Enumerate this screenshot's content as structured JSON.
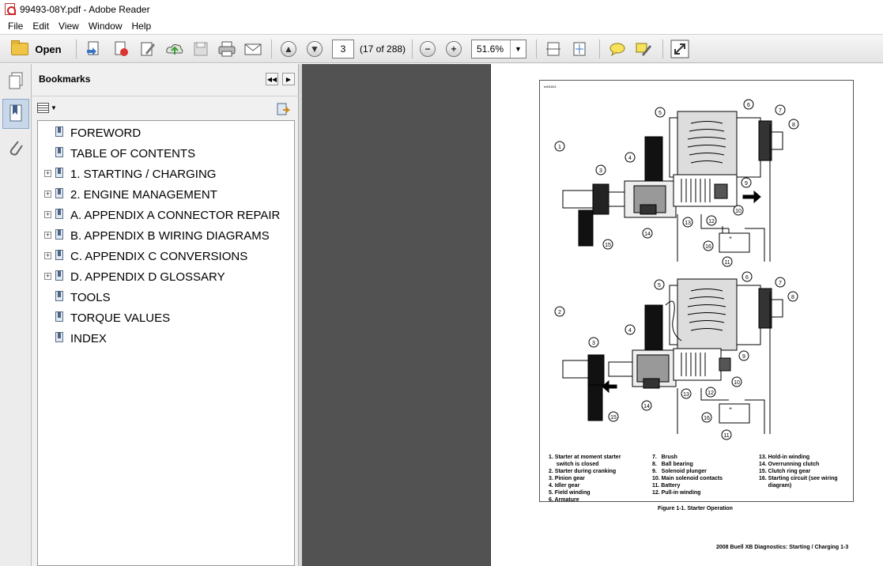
{
  "window": {
    "title": "99493-08Y.pdf - Adobe Reader"
  },
  "menu": [
    "File",
    "Edit",
    "View",
    "Window",
    "Help"
  ],
  "toolbar": {
    "open_label": "Open",
    "page_value": "3",
    "page_count": "(17 of 288)",
    "zoom_value": "51.6%"
  },
  "bookmarks": {
    "title": "Bookmarks",
    "items": [
      {
        "label": "FOREWORD",
        "expandable": false
      },
      {
        "label": "TABLE OF CONTENTS",
        "expandable": false
      },
      {
        "label": "1. STARTING / CHARGING",
        "expandable": true
      },
      {
        "label": "2. ENGINE MANAGEMENT",
        "expandable": true
      },
      {
        "label": "A. APPENDIX A CONNECTOR REPAIR",
        "expandable": true
      },
      {
        "label": "B. APPENDIX B WIRING DIAGRAMS",
        "expandable": true
      },
      {
        "label": "C. APPENDIX C CONVERSIONS",
        "expandable": true
      },
      {
        "label": "D. APPENDIX D GLOSSARY",
        "expandable": true
      },
      {
        "label": "TOOLS",
        "expandable": false
      },
      {
        "label": "TORQUE VALUES",
        "expandable": false
      },
      {
        "label": "INDEX",
        "expandable": false
      }
    ]
  },
  "document": {
    "figure_id": "ed01624",
    "callouts": [
      "1",
      "2",
      "3",
      "4",
      "5",
      "6",
      "7",
      "8",
      "9",
      "10",
      "11",
      "12",
      "13",
      "14",
      "15",
      "16"
    ],
    "legend_col1": [
      "1.  Starter at moment starter",
      "     switch is closed",
      "2.  Starter during cranking",
      "3.  Pinion gear",
      "4.  Idler gear",
      "5.  Field winding",
      "6.  Armature"
    ],
    "legend_col2": [
      "7.   Brush",
      "8.   Ball bearing",
      "9.   Solenoid plunger",
      "10. Main solenoid contacts",
      "11. Battery",
      "12. Pull-in winding"
    ],
    "legend_col3": [
      "13. Hold-in winding",
      "14. Overrunning clutch",
      "15. Clutch ring gear",
      "16. Starting circuit (see wiring",
      "      diagram)"
    ],
    "caption": "Figure 1-1. Starter Operation",
    "footer": "2008 Buell XB Diagnostics:  Starting / Charging  1-3"
  }
}
